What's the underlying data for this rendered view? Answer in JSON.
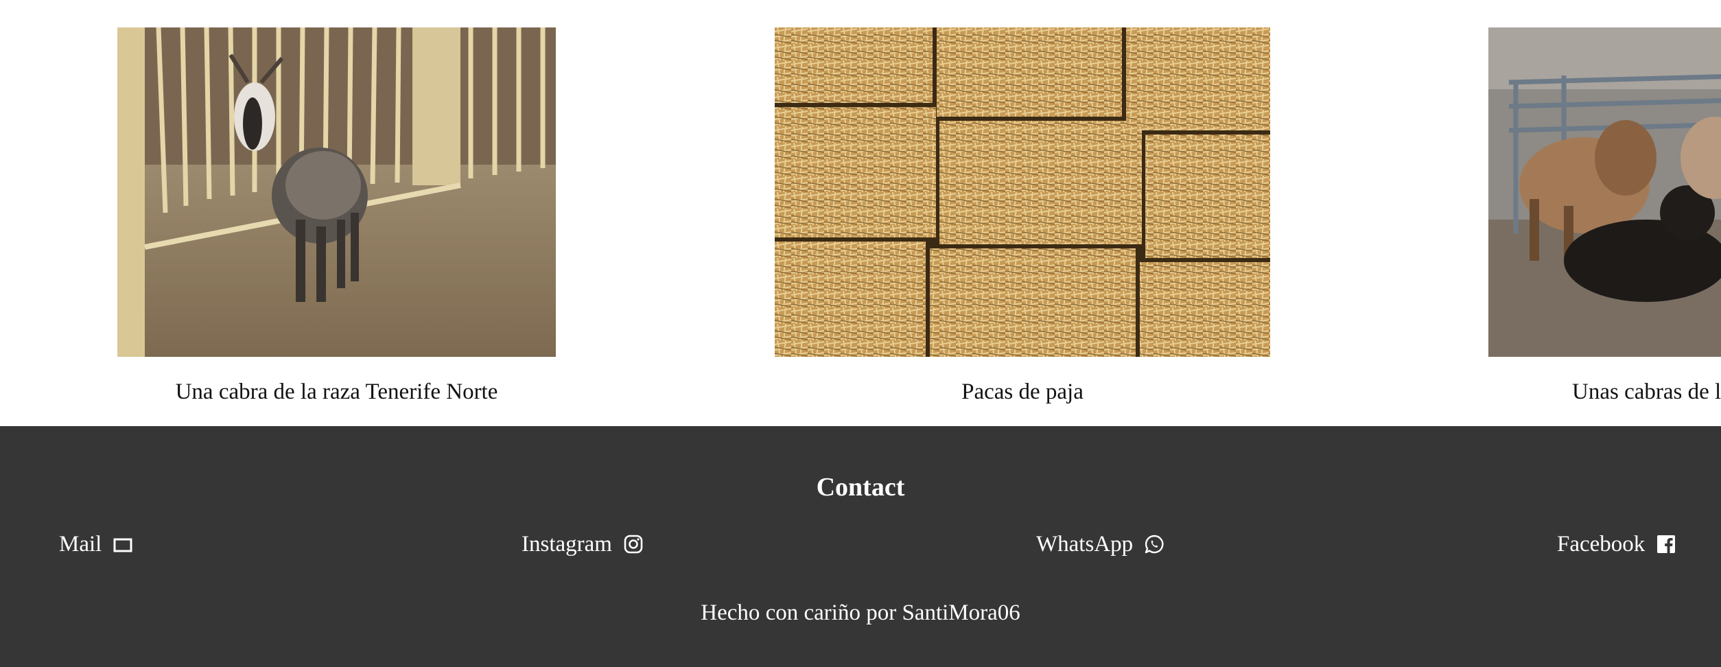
{
  "gallery": {
    "items": [
      {
        "caption": "Una cabra de la raza Tenerife Norte",
        "image": "goat-in-pen-photo"
      },
      {
        "caption": "Pacas de paja",
        "image": "straw-bales-photo"
      },
      {
        "caption": "Unas cabras de la",
        "image": "goats-group-photo"
      }
    ]
  },
  "footer": {
    "title": "Contact",
    "links": [
      {
        "label": "Mail",
        "icon": "mail-icon"
      },
      {
        "label": "Instagram",
        "icon": "instagram-icon"
      },
      {
        "label": "WhatsApp",
        "icon": "whatsapp-icon"
      },
      {
        "label": "Facebook",
        "icon": "facebook-icon"
      }
    ],
    "credits": "Hecho con cariño por SantiMora06"
  },
  "colors": {
    "footer_bg": "#363636",
    "footer_text": "#ffffff",
    "page_bg": "#ffffff"
  }
}
